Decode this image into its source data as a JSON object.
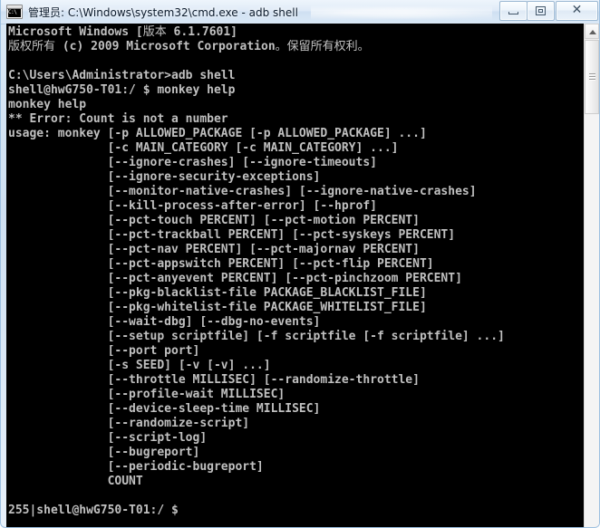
{
  "window": {
    "title": "管理员: C:\\Windows\\system32\\cmd.exe - adb  shell",
    "icon_name": "cmd-icon",
    "icon_prompt_text": "C:\\",
    "controls": {
      "minimize_label": "",
      "maximize_label": "",
      "close_label": "✕"
    },
    "colors": {
      "console_background": "#000000",
      "console_foreground": "#c0c0c0",
      "title_text": "#0b1a2b",
      "frame": "#cfe0f1"
    }
  },
  "console": {
    "lines": [
      "Microsoft Windows [版本 6.1.7601]",
      "版权所有 (c) 2009 Microsoft Corporation。保留所有权利。",
      "",
      "C:\\Users\\Administrator>adb shell",
      "shell@hwG750-T01:/ $ monkey help",
      "monkey help",
      "** Error: Count is not a number",
      "usage: monkey [-p ALLOWED_PACKAGE [-p ALLOWED_PACKAGE] ...]",
      "              [-c MAIN_CATEGORY [-c MAIN_CATEGORY] ...]",
      "              [--ignore-crashes] [--ignore-timeouts]",
      "              [--ignore-security-exceptions]",
      "              [--monitor-native-crashes] [--ignore-native-crashes]",
      "              [--kill-process-after-error] [--hprof]",
      "              [--pct-touch PERCENT] [--pct-motion PERCENT]",
      "              [--pct-trackball PERCENT] [--pct-syskeys PERCENT]",
      "              [--pct-nav PERCENT] [--pct-majornav PERCENT]",
      "              [--pct-appswitch PERCENT] [--pct-flip PERCENT]",
      "              [--pct-anyevent PERCENT] [--pct-pinchzoom PERCENT]",
      "              [--pkg-blacklist-file PACKAGE_BLACKLIST_FILE]",
      "              [--pkg-whitelist-file PACKAGE_WHITELIST_FILE]",
      "              [--wait-dbg] [--dbg-no-events]",
      "              [--setup scriptfile] [-f scriptfile [-f scriptfile] ...]",
      "              [--port port]",
      "              [-s SEED] [-v [-v] ...]",
      "              [--throttle MILLISEC] [--randomize-throttle]",
      "              [--profile-wait MILLISEC]",
      "              [--device-sleep-time MILLISEC]",
      "              [--randomize-script]",
      "              [--script-log]",
      "              [--bugreport]",
      "              [--periodic-bugreport]",
      "              COUNT",
      "",
      "255|shell@hwG750-T01:/ $ "
    ]
  },
  "scrollbar": {
    "up_arrow_name": "scroll-up-arrow",
    "thumb_name": "scroll-thumb"
  }
}
